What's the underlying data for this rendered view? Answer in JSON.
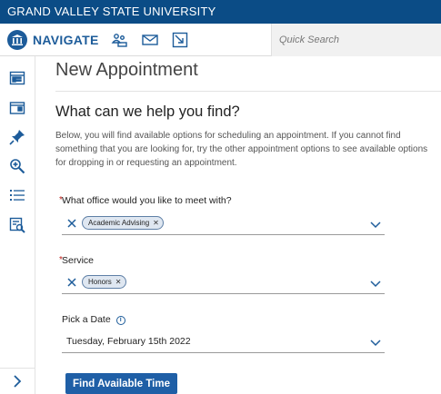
{
  "topbar": {
    "university": "GRAND VALLEY STATE UNIVERSITY"
  },
  "navbar": {
    "brand": "NAVIGATE",
    "icons": [
      "people-icon",
      "mail-icon",
      "open-link-icon"
    ],
    "search_placeholder": "Quick Search"
  },
  "sidebar": {
    "icons": [
      "calendar-icon",
      "folder-icon",
      "pin-icon",
      "search-icon",
      "list-icon",
      "report-search-icon"
    ],
    "expand_icon": "chevron-right-icon"
  },
  "main": {
    "page_title": "New Appointment",
    "section_title": "What can we help you find?",
    "description": "Below, you will find available options for scheduling an appointment. If you cannot find something that you are looking for, try the other appointment options to see available options for dropping in or requesting an appointment.",
    "office": {
      "required_mark": "*",
      "label": "What office would you like to meet with?",
      "selected": "Academic Advising"
    },
    "service": {
      "required_mark": "*",
      "label": "Service",
      "selected": "Honors"
    },
    "date": {
      "label": "Pick a Date",
      "info_icon": "i",
      "value": "Tuesday, February 15th 2022"
    },
    "submit_label": "Find Available Time"
  },
  "colors": {
    "topbar": "#0b4c86",
    "brand": "#1d5c9a",
    "button": "#1f5fa6",
    "required": "#c0231e"
  }
}
